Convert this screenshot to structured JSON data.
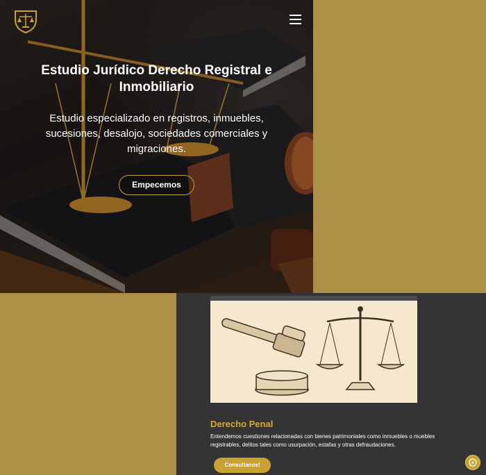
{
  "hero": {
    "title": "Estudio Jurídico Derecho Registral e Inmobiliario",
    "subtitle": "Estudio especializado en registros, inmuebles, sucesiones, desalojo, sociedades comerciales y migraciones.",
    "cta_label": "Empecemos"
  },
  "service": {
    "title": "Derecho Penal",
    "description": "Entendemos cuestiones relacionadas con bienes patrimoniales como inmuebles o muebles registrables, delitos tales como usurpación, estafas y otras defraudaciones.",
    "cta_label": "Consultanos!"
  },
  "icons": {
    "logo": "scales-of-justice-shield",
    "menu": "hamburger-menu-icon",
    "whatsapp": "whatsapp-icon"
  },
  "colors": {
    "gold": "#ab9046",
    "accent": "#c9a234",
    "dark": "#343436",
    "card_image_bg": "#f5e8cf"
  }
}
